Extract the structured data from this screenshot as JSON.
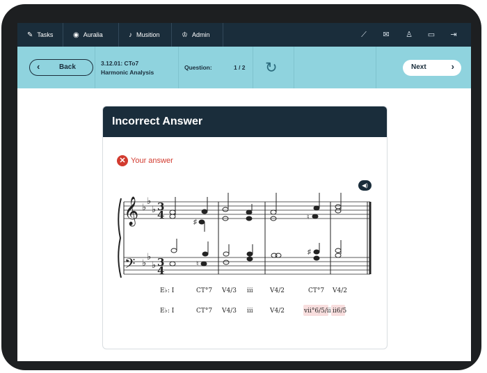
{
  "nav": {
    "tabs": [
      {
        "icon": "edit-icon",
        "label": "Tasks"
      },
      {
        "icon": "auralia-icon",
        "label": "Auralia"
      },
      {
        "icon": "musition-icon",
        "label": "Musition"
      },
      {
        "icon": "admin-icon",
        "label": "Admin"
      }
    ],
    "right_icons": [
      "chart-icon",
      "mail-icon",
      "user-icon",
      "display-icon",
      "logout-icon"
    ]
  },
  "lesson": {
    "back_label": "Back",
    "code": "3.12.01: CTo7",
    "title": "Harmonic Analysis",
    "question_label": "Question:",
    "question_count": "1 / 2",
    "next_label": "Next"
  },
  "result": {
    "header": "Incorrect Answer",
    "status": "Your answer"
  },
  "analysis": {
    "key": "E♭: I",
    "correct_row": [
      "CT°7",
      "V4/3",
      "iii",
      "V4/2",
      "CT°7",
      "V4/2"
    ],
    "user_row": [
      "CT°7",
      "V4/3",
      "iii",
      "V4/2",
      "vii°6/5/ii",
      "ii6/5"
    ],
    "incorrect_indexes": [
      4,
      5
    ]
  },
  "colors": {
    "topbar": "#1a2d3b",
    "subbar": "#8fd3de",
    "error": "#d23b2f",
    "error_highlight": "#f8dede"
  }
}
